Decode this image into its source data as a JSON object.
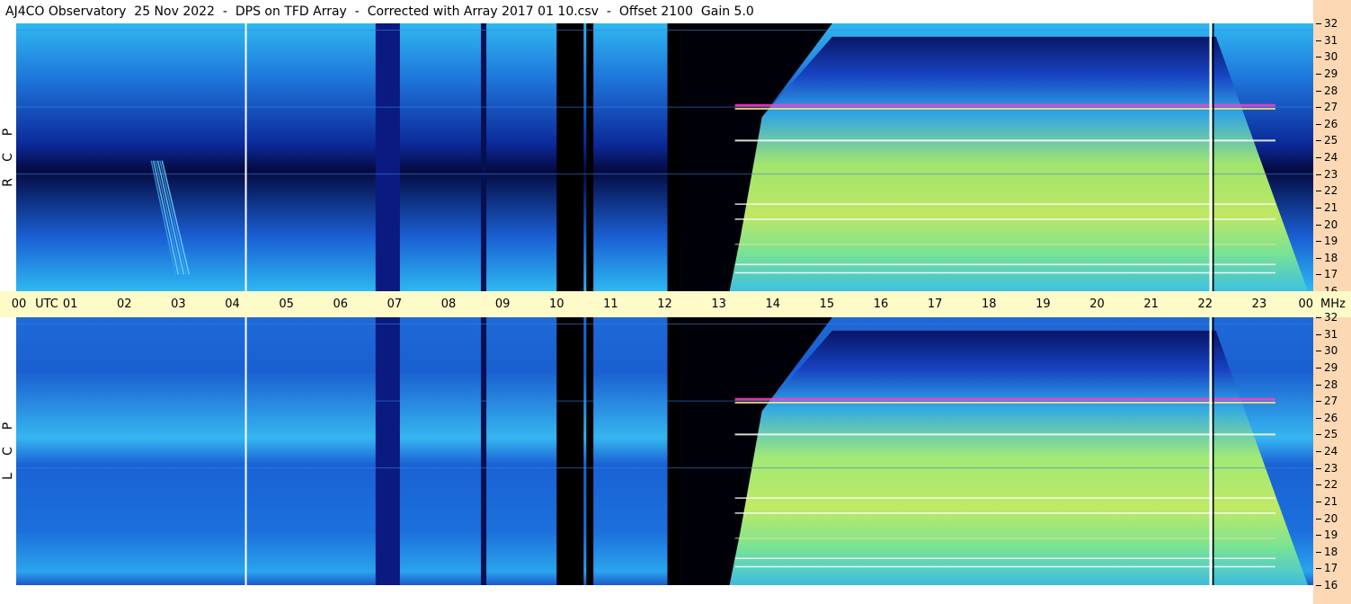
{
  "title": {
    "observatory": "AJ4CO Observatory",
    "date": "25 Nov 2022",
    "mode": "DPS on TFD Array",
    "correction": "Corrected with Array 2017 01 10.csv",
    "offset": "Offset 2100",
    "gain": "Gain 5.0",
    "separator": "-"
  },
  "chart_data": [
    {
      "type": "heatmap",
      "name": "R C P",
      "polarization_letters": [
        "R",
        "C",
        "P"
      ],
      "x_unit": "UTC",
      "y_unit": "MHz",
      "x_ticks": [
        "00",
        "01",
        "02",
        "03",
        "04",
        "05",
        "06",
        "07",
        "08",
        "09",
        "10",
        "11",
        "12",
        "13",
        "14",
        "15",
        "16",
        "17",
        "18",
        "19",
        "20",
        "21",
        "22",
        "23",
        "00"
      ],
      "y_ticks": [
        "32",
        "31",
        "30",
        "29",
        "28",
        "27",
        "26",
        "25",
        "24",
        "23",
        "22",
        "21",
        "20",
        "19",
        "18",
        "17",
        "16"
      ],
      "xlim": [
        0,
        24
      ],
      "ylim": [
        16,
        32
      ]
    },
    {
      "type": "heatmap",
      "name": "L C P",
      "polarization_letters": [
        "L",
        "C",
        "P"
      ],
      "x_unit": "UTC",
      "y_unit": "MHz",
      "x_ticks": [
        "00",
        "01",
        "02",
        "03",
        "04",
        "05",
        "06",
        "07",
        "08",
        "09",
        "10",
        "11",
        "12",
        "13",
        "14",
        "15",
        "16",
        "17",
        "18",
        "19",
        "20",
        "21",
        "22",
        "23",
        "00"
      ],
      "y_ticks": [
        "32",
        "31",
        "30",
        "29",
        "28",
        "27",
        "26",
        "25",
        "24",
        "23",
        "22",
        "21",
        "20",
        "19",
        "18",
        "17",
        "16"
      ],
      "xlim": [
        0,
        24
      ],
      "ylim": [
        16,
        32
      ]
    }
  ],
  "axis": {
    "utc_label": "UTC",
    "mhz_label": "MHz"
  },
  "colors": {
    "background_strip": "#fffbc8",
    "freq_axis_bg": "#fcd8b4"
  }
}
